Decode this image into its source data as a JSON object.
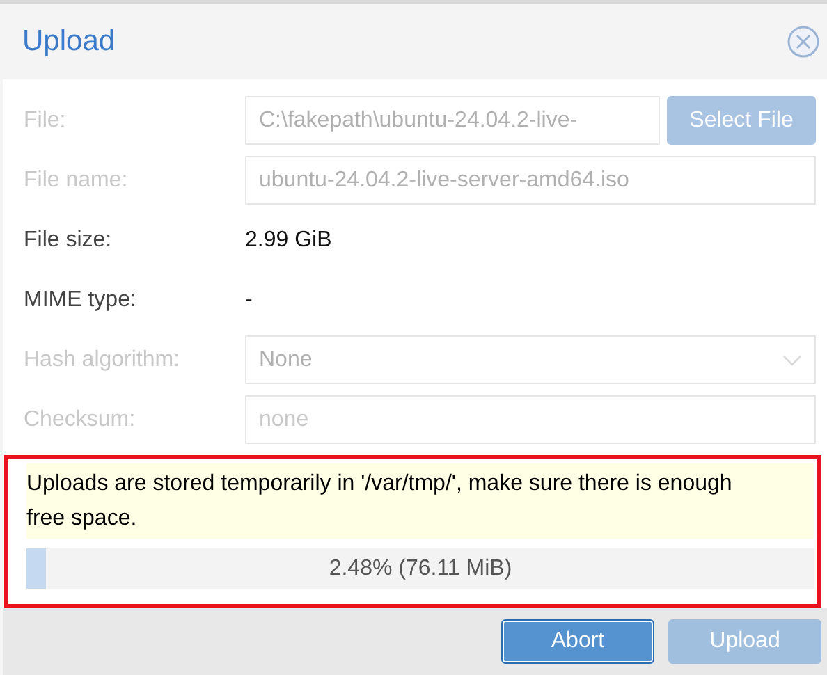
{
  "dialog": {
    "title": "Upload"
  },
  "fields": [
    {
      "kind": "file",
      "label": "File:",
      "value": "C:\\fakepath\\ubuntu-24.04.2-live-",
      "button": "Select File",
      "disabled": true
    },
    {
      "kind": "text",
      "label": "File name:",
      "value": "ubuntu-24.04.2-live-server-amd64.iso",
      "disabled": true
    },
    {
      "kind": "display",
      "label": "File size:",
      "value": "2.99 GiB",
      "disabled": false
    },
    {
      "kind": "display",
      "label": "MIME type:",
      "value": "-",
      "disabled": false
    },
    {
      "kind": "select",
      "label": "Hash algorithm:",
      "value": "None",
      "disabled": true
    },
    {
      "kind": "text",
      "label": "Checksum:",
      "placeholder": "none",
      "disabled": true
    }
  ],
  "status": {
    "highlighted": true,
    "notice": "Uploads are stored temporarily in '/var/tmp/', make sure there is enough free space.",
    "progress": {
      "level": 0.0248,
      "reading": "2.48% (76.11 MiB)"
    }
  },
  "buttons": [
    {
      "label": "Abort",
      "disabled": false
    },
    {
      "label": "Upload",
      "disabled": true
    }
  ]
}
